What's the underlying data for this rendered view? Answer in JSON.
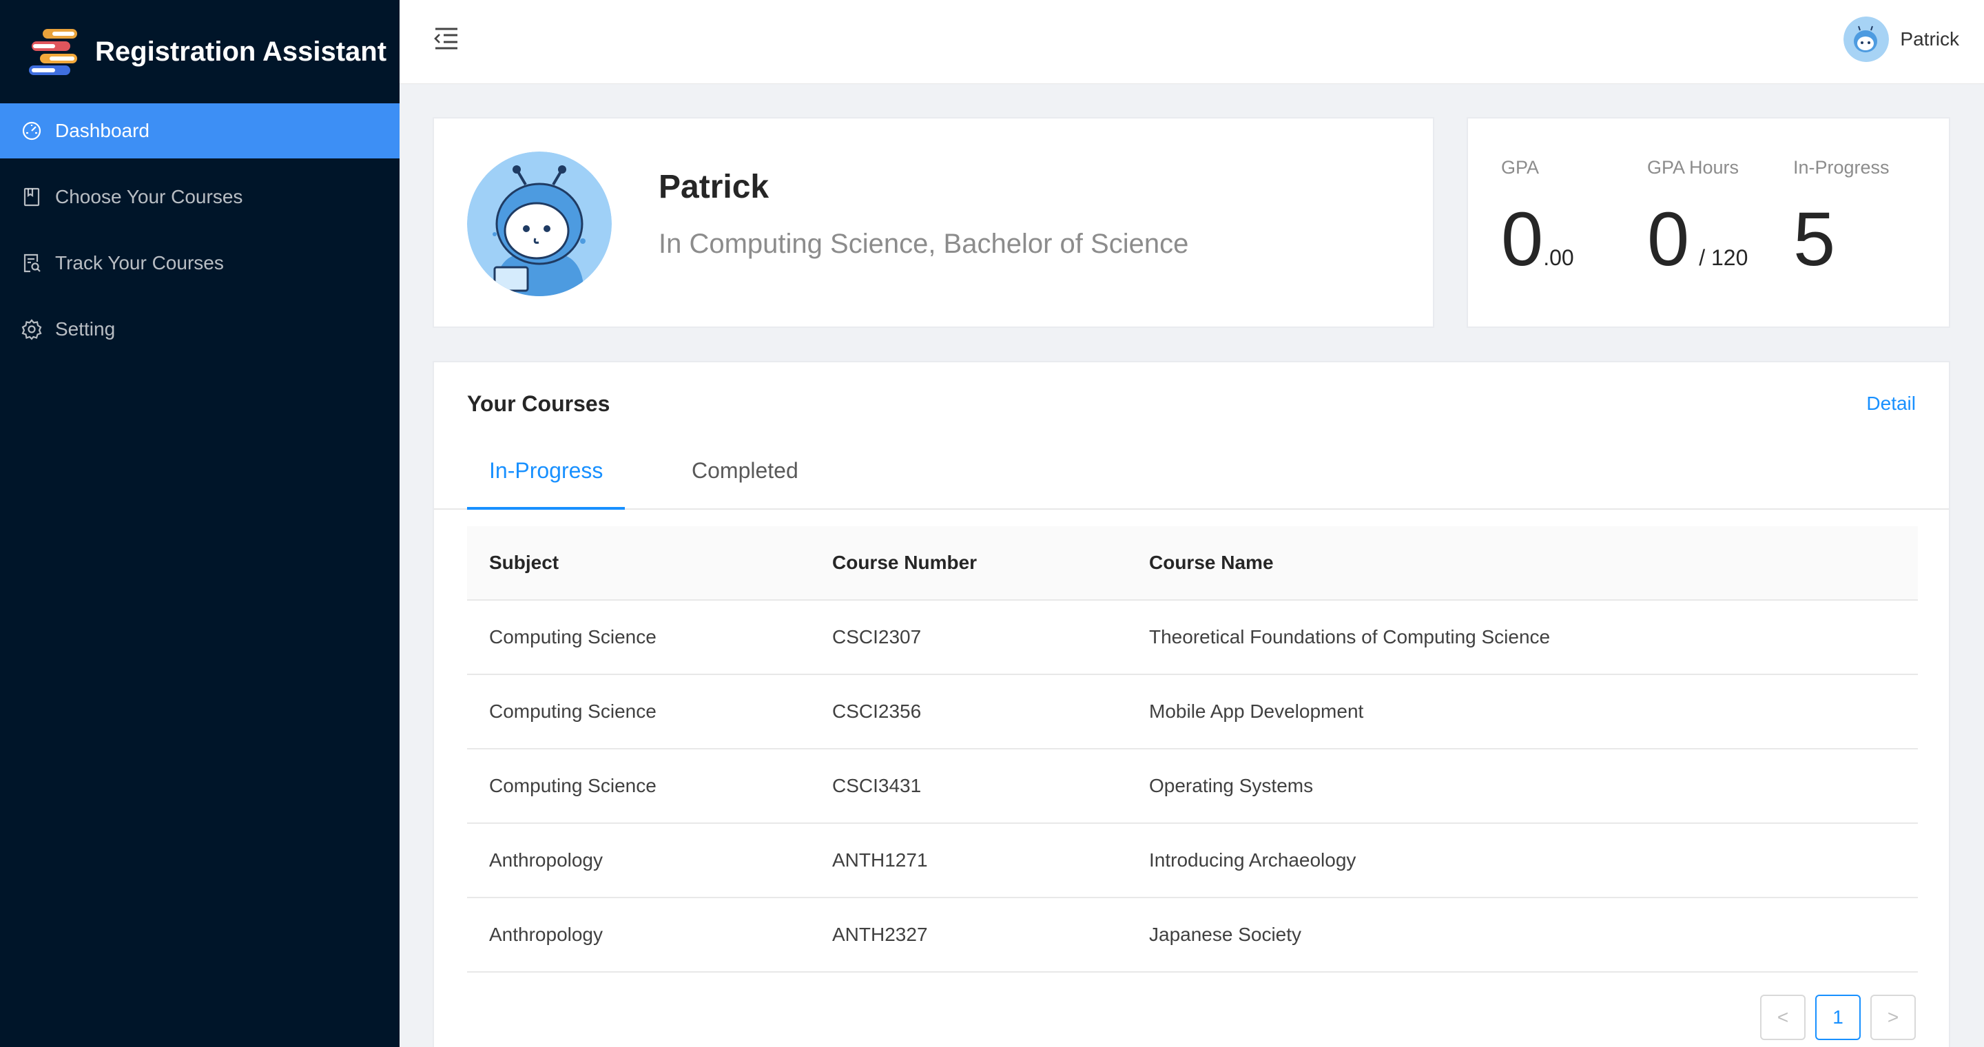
{
  "app": {
    "title": "Registration Assistant",
    "logo_icon": "books-stack-icon"
  },
  "sidebar": {
    "items": [
      {
        "label": "Dashboard",
        "icon": "dashboard-icon",
        "active": true
      },
      {
        "label": "Choose Your Courses",
        "icon": "book-icon",
        "active": false
      },
      {
        "label": "Track Your Courses",
        "icon": "file-search-icon",
        "active": false
      },
      {
        "label": "Setting",
        "icon": "gear-icon",
        "active": false
      }
    ]
  },
  "header": {
    "fold_icon": "menu-fold-icon",
    "user_name": "Patrick"
  },
  "profile": {
    "name": "Patrick",
    "degree": "In Computing Science, Bachelor of Science"
  },
  "stats": {
    "gpa": {
      "label": "GPA",
      "value": "0",
      "suffix": ".00"
    },
    "gpa_hours": {
      "label": "GPA Hours",
      "value": "0",
      "suffix": "/ 120"
    },
    "in_progress": {
      "label": "In-Progress",
      "value": "5"
    }
  },
  "courses": {
    "title": "Your Courses",
    "detail_label": "Detail",
    "tabs": [
      {
        "label": "In-Progress",
        "active": true
      },
      {
        "label": "Completed",
        "active": false
      }
    ],
    "columns": [
      "Subject",
      "Course Number",
      "Course Name"
    ],
    "rows": [
      [
        "Computing Science",
        "CSCI2307",
        "Theoretical Foundations of Computing Science"
      ],
      [
        "Computing Science",
        "CSCI2356",
        "Mobile App Development"
      ],
      [
        "Computing Science",
        "CSCI3431",
        "Operating Systems"
      ],
      [
        "Anthropology",
        "ANTH1271",
        "Introducing Archaeology"
      ],
      [
        "Anthropology",
        "ANTH2327",
        "Japanese Society"
      ]
    ],
    "pagination": {
      "prev": "<",
      "current": "1",
      "next": ">"
    }
  },
  "colors": {
    "sidebar_bg": "#001529",
    "accent": "#1890ff",
    "active_menu": "#3d8ff5"
  }
}
